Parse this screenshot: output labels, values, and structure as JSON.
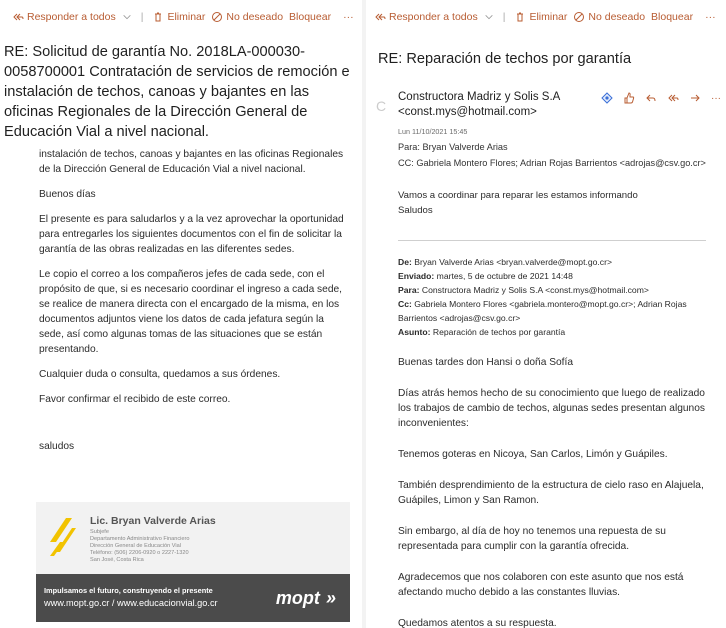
{
  "toolbar": {
    "reply_all": "Responder a todos",
    "delete": "Eliminar",
    "junk": "No deseado",
    "block": "Bloquear",
    "more": "···"
  },
  "left": {
    "subject": "RE: Solicitud de garantía No. 2018LA-000030-0058700001 Contratación de servicios de remoción e instalación de techos, canoas y bajantes en las oficinas Regionales de la Dirección General de Educación Vial a nivel nacional.",
    "body_cut": "instalación de techos, canoas y bajantes en las oficinas Regionales de la Dirección General de Educación Vial a nivel nacional.",
    "greeting": "Buenos días",
    "p1": "El presente es para saludarlos y a la vez aprovechar la oportunidad para entregarles los siguientes documentos con el fin de solicitar la garantía de las obras realizadas en las diferentes sedes.",
    "p2": "Le copio el correo a los compañeros jefes de cada sede, con el propósito de que, si es necesario coordinar el ingreso a cada sede, se realice de manera directa con el encargado de la misma, en los documentos adjuntos viene los datos de cada jefatura según la sede, así como algunas tomas de las situaciones que se están presentando.",
    "p3": "Cualquier duda o consulta, quedamos a sus órdenes.",
    "p4": "Favor confirmar el recibido de este correo.",
    "closing": "saludos",
    "signature": {
      "name": "Lic. Bryan Valverde Arias",
      "lines": [
        "Subjefe",
        "Departamento Administrativo Financiero",
        "Dirección General de Educación Vial",
        "Teléfono: (506) 2206-0920 o 2227-1320",
        "San José, Costa Rica"
      ],
      "slogan": "Impulsamos el futuro, construyendo el presente",
      "urls": "www.mopt.go.cr / www.educacionvial.go.cr",
      "brand": "mopt"
    }
  },
  "right": {
    "subject": "RE: Reparación de techos por garantía",
    "avatar_initial": "C",
    "sender_name": "Constructora Madriz y Solis S.A",
    "sender_email": "<const.mys@hotmail.com>",
    "date": "Lun 11/10/2021 15:45",
    "to": "Para:  Bryan Valverde Arias",
    "cc": "CC:  Gabriela Montero Flores; Adrian Rojas Barrientos <adrojas@csv.go.cr>",
    "reply_l1": "Vamos a coordinar para reparar les estamos informando",
    "reply_l2": "Saludos",
    "quoted": {
      "de_label": "De:",
      "de_value": " Bryan Valverde Arias <bryan.valverde@mopt.go.cr>",
      "enviado_label": "Enviado:",
      "enviado_value": " martes, 5 de octubre de 2021 14:48",
      "para_label": "Para:",
      "para_value": " Constructora Madriz y Solis S.A <const.mys@hotmail.com>",
      "cc_label": "Cc:",
      "cc_value": " Gabriela Montero Flores <gabriela.montero@mopt.go.cr>; Adrian Rojas Barrientos <adrojas@csv.go.cr>",
      "asunto_label": "Asunto:",
      "asunto_value": " Reparación de techos por garantía"
    },
    "p_greet": "Buenas tardes don Hansi o doña Sofía",
    "p1": "Días atrás hemos hecho de su conocimiento que luego de realizado los trabajos de cambio de techos, algunas sedes presentan algunos inconvenientes:",
    "p2": "Tenemos goteras en Nicoya, San Carlos, Limón y Guápiles.",
    "p3": "También desprendimiento de la estructura de cielo raso en Alajuela, Guápiles, Limon y San Ramon.",
    "p4": "Sin embargo, al día de hoy no tenemos una repuesta de su representada para cumplir con la garantía ofrecida.",
    "p5": "Agradecemos que nos colaboren con este asunto que nos está afectando mucho debido a las constantes lluvias.",
    "p6": "Quedamos atentos a su respuesta."
  },
  "colors": {
    "toolbar_accent": "#b85c32",
    "action_blue": "#3a6fd8",
    "signature_band": "#4b4b4b",
    "logo_yellow": "#f2c300"
  }
}
